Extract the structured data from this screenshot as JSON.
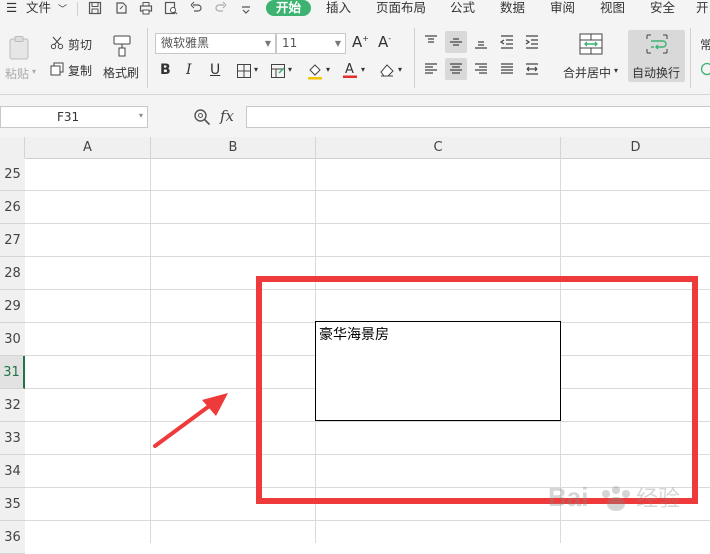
{
  "menubar": {
    "file": "文件",
    "tabs": [
      "开始",
      "插入",
      "页面布局",
      "公式",
      "数据",
      "审阅",
      "视图",
      "安全",
      "开"
    ]
  },
  "ribbon": {
    "paste": "粘贴",
    "cut": "剪切",
    "copy": "复制",
    "format_painter": "格式刷",
    "font_name": "微软雅黑",
    "font_size": "11",
    "merge_center": "合并居中",
    "wrap_text": "自动换行",
    "overflow_label": "常"
  },
  "formula_bar": {
    "name_box": "F31",
    "fx_label": "fx",
    "formula_value": ""
  },
  "sheet": {
    "columns": [
      "A",
      "B",
      "C",
      "D"
    ],
    "rows": [
      "25",
      "26",
      "27",
      "28",
      "29",
      "30",
      "31",
      "32",
      "33",
      "34",
      "35",
      "36"
    ],
    "active_row": "31",
    "cell_text": "豪华海景房"
  },
  "colors": {
    "active_tab": "#3cb371",
    "annotation": "#ee3a3a",
    "active_row_header": "#217346"
  },
  "watermark": "Baidu经验"
}
